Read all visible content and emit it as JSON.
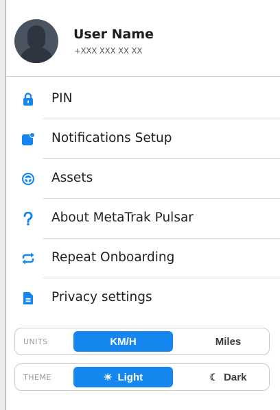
{
  "profile": {
    "name": "User Name",
    "phone": "+XXX XXX XX XX"
  },
  "menu": [
    {
      "label": "PIN",
      "icon": "lock-icon"
    },
    {
      "label": "Notifications Setup",
      "icon": "notification-badge-icon"
    },
    {
      "label": "Assets",
      "icon": "steering-wheel-icon"
    },
    {
      "label": "About MetaTrak Pulsar",
      "icon": "question-mark-icon"
    },
    {
      "label": "Repeat Onboarding",
      "icon": "repeat-icon"
    },
    {
      "label": "Privacy settings",
      "icon": "document-icon"
    }
  ],
  "units": {
    "label": "UNITS",
    "options": [
      "KM/H",
      "Miles"
    ],
    "selected": "KM/H"
  },
  "theme": {
    "label": "THEME",
    "options": [
      "Light",
      "Dark"
    ],
    "selected": "Light"
  },
  "colors": {
    "accent": "#1787f0",
    "avatar": "#4a5360"
  }
}
